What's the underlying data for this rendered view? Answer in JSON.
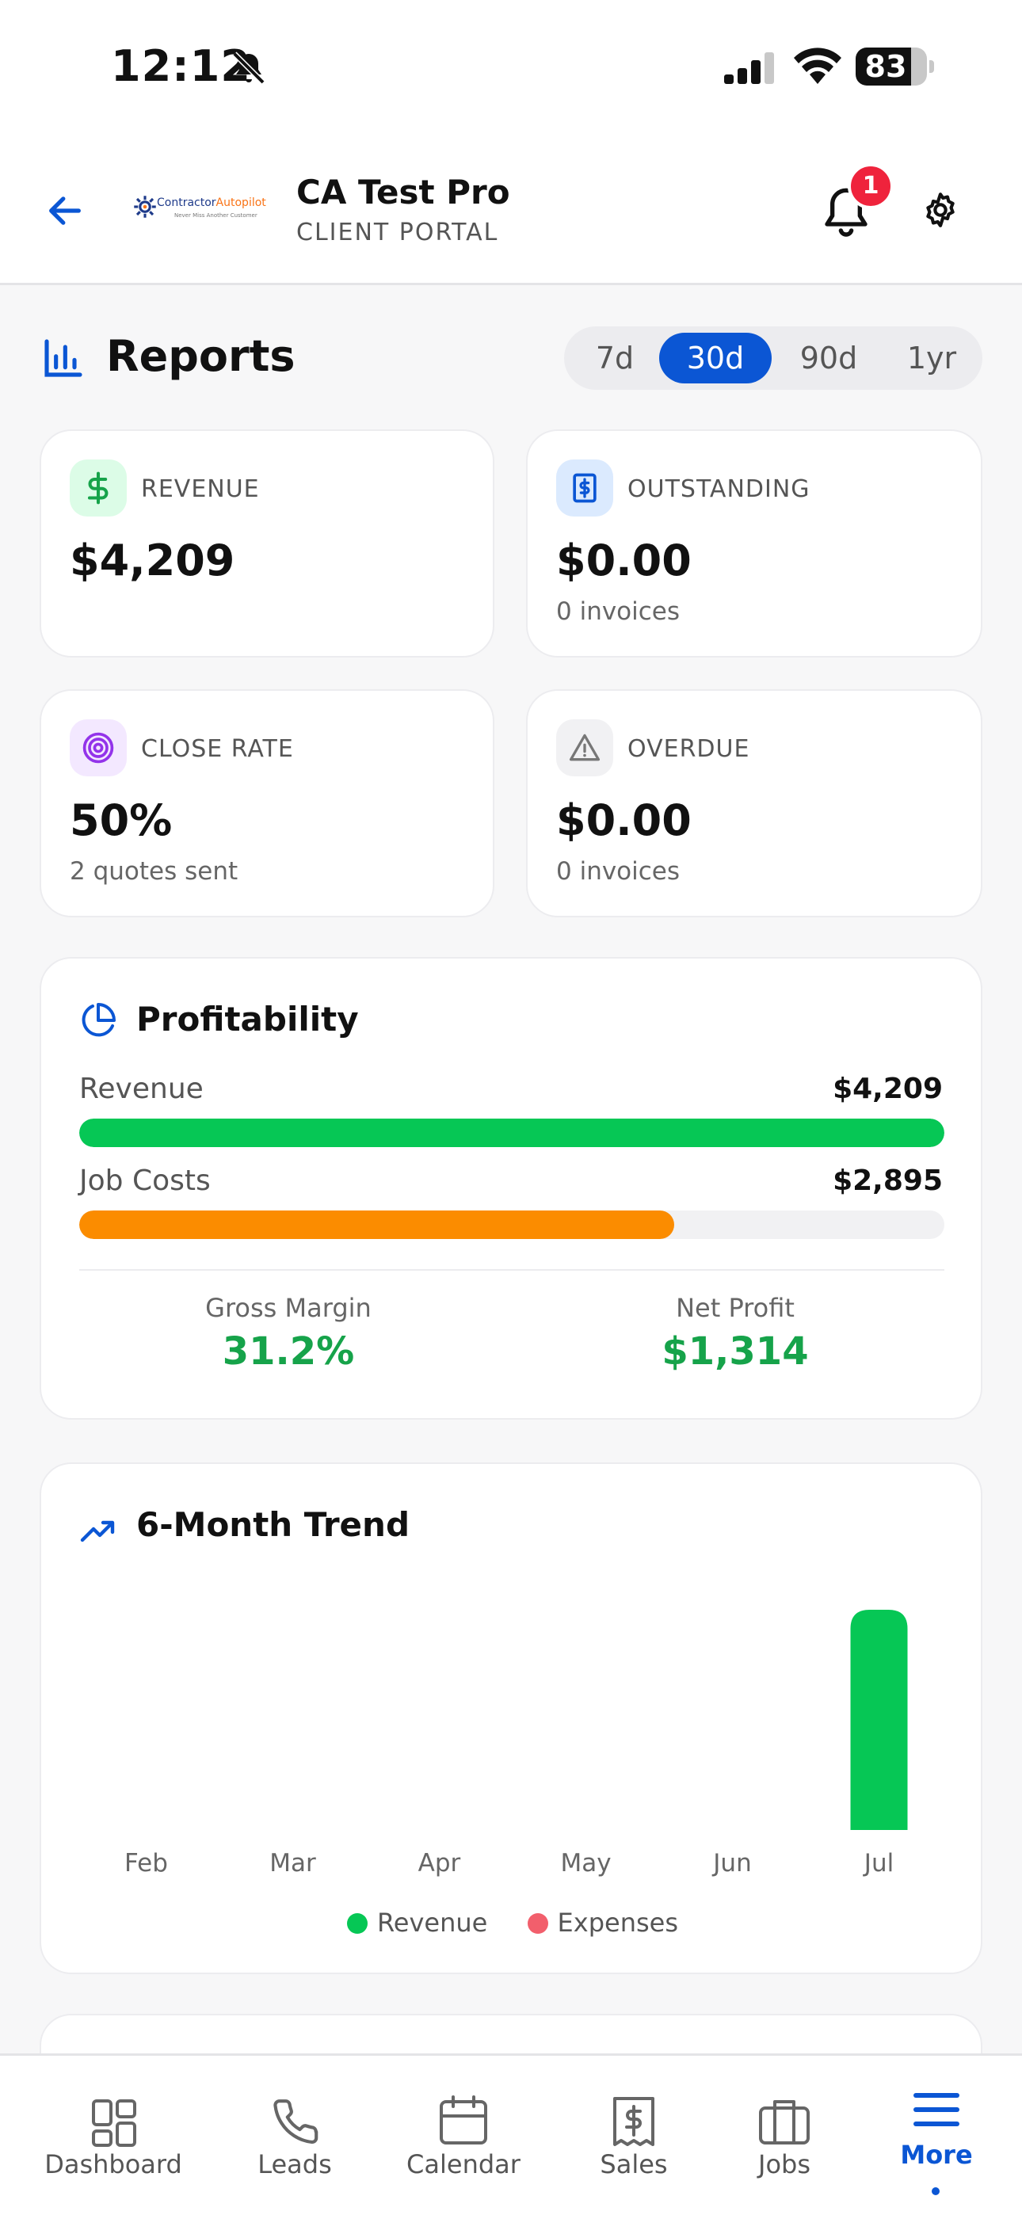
{
  "status_bar": {
    "time": "12:12",
    "battery": "83"
  },
  "header": {
    "logo_text_a": "Contractor",
    "logo_text_b": "Autopilot",
    "logo_tagline": "Never Miss Another Customer",
    "company_name": "CA Test Pro",
    "portal_label": "CLIENT PORTAL",
    "notification_count": "1"
  },
  "reports": {
    "title": "Reports",
    "ranges": [
      "7d",
      "30d",
      "90d",
      "1yr"
    ],
    "active_range": "30d"
  },
  "stats": {
    "revenue": {
      "label": "REVENUE",
      "value": "$4,209",
      "sub": ""
    },
    "outstanding": {
      "label": "OUTSTANDING",
      "value": "$0.00",
      "sub": "0 invoices"
    },
    "close_rate": {
      "label": "CLOSE RATE",
      "value": "50%",
      "sub": "2 quotes sent"
    },
    "overdue": {
      "label": "OVERDUE",
      "value": "$0.00",
      "sub": "0 invoices"
    }
  },
  "profitability": {
    "title": "Profitability",
    "revenue_label": "Revenue",
    "revenue_value": "$4,209",
    "revenue_fraction": 1.0,
    "costs_label": "Job Costs",
    "costs_value": "$2,895",
    "costs_fraction": 0.688,
    "gross_margin_label": "Gross Margin",
    "gross_margin_value": "31.2%",
    "net_profit_label": "Net Profit",
    "net_profit_value": "$1,314"
  },
  "trend": {
    "title": "6-Month Trend",
    "legend_revenue": "Revenue",
    "legend_expenses": "Expenses"
  },
  "colors": {
    "accent": "#0b56d4",
    "revenue_green": "#06c755",
    "cost_orange": "#fb8c00",
    "profit_green": "#16a34a",
    "expense_red": "#f25f6c"
  },
  "chart_data": {
    "type": "bar",
    "title": "6-Month Trend",
    "categories": [
      "Feb",
      "Mar",
      "Apr",
      "May",
      "Jun",
      "Jul"
    ],
    "series": [
      {
        "name": "Revenue",
        "values": [
          0,
          0,
          0,
          0,
          0,
          4209
        ]
      },
      {
        "name": "Expenses",
        "values": [
          0,
          0,
          0,
          0,
          0,
          0
        ]
      }
    ],
    "ylim": [
      0,
      4209
    ],
    "grid": false,
    "legend": "bottom"
  },
  "nav": {
    "items": [
      {
        "label": "Dashboard",
        "icon": "dashboard-grid-icon"
      },
      {
        "label": "Leads",
        "icon": "phone-icon"
      },
      {
        "label": "Calendar",
        "icon": "calendar-icon"
      },
      {
        "label": "Sales",
        "icon": "receipt-icon"
      },
      {
        "label": "Jobs",
        "icon": "briefcase-icon"
      },
      {
        "label": "More",
        "icon": "menu-icon"
      }
    ],
    "active": "More"
  }
}
